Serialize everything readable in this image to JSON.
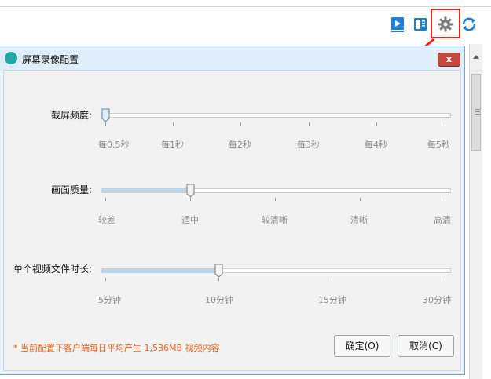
{
  "toolbar": {
    "icons": [
      "play-doc-icon",
      "sidebar-panel-icon",
      "gear-icon",
      "refresh-icon"
    ]
  },
  "dialog": {
    "title": "屏幕录像配置",
    "close_label": "x",
    "sliders": [
      {
        "label": "截屏频度:",
        "ticks": [
          "每0.5秒",
          "每1秒",
          "每2秒",
          "每3秒",
          "每4秒",
          "每5秒"
        ],
        "value_fraction": 0.0
      },
      {
        "label": "画面质量:",
        "ticks": [
          "较差",
          "适中",
          "较清晰",
          "清晰",
          "高清"
        ],
        "value_fraction": 0.25
      },
      {
        "label": "单个视频文件时长:",
        "ticks": [
          "5分钟",
          "10分钟",
          "15分钟",
          "30分钟"
        ],
        "value_fraction": 0.333
      }
    ],
    "note": "* 当前配置下客户端每日平均产生 1,536MB 视频内容",
    "ok_label": "确定(O)",
    "cancel_label": "取消(C)"
  },
  "colors": {
    "highlight_box": "#e8261e",
    "note_text": "#e0651d",
    "accent_blue": "#1e7fd6"
  }
}
